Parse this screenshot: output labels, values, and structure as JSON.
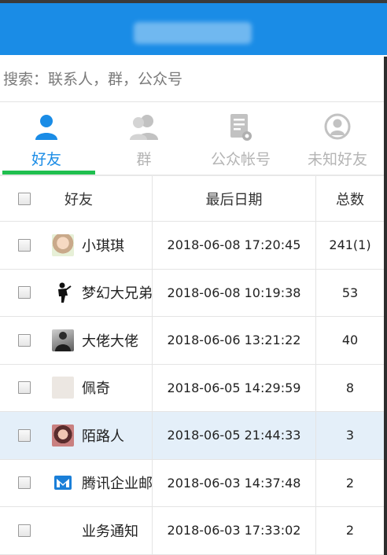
{
  "header": {
    "title": ""
  },
  "search": {
    "placeholder": "搜索：联系人，群，公众号",
    "value": ""
  },
  "tabs": [
    {
      "label": "好友",
      "icon": "user-icon",
      "active": true
    },
    {
      "label": "群",
      "icon": "group-icon",
      "active": false
    },
    {
      "label": "公众帐号",
      "icon": "official-account-icon",
      "active": false
    },
    {
      "label": "未知好友",
      "icon": "unknown-friend-icon",
      "active": false
    }
  ],
  "table": {
    "columns": [
      "好友",
      "最后日期",
      "总数"
    ],
    "rows": [
      {
        "name": "小琪琪",
        "date": "2018-06-08 17:20:45",
        "count": "241(1)",
        "avatar": "photo-avatar"
      },
      {
        "name": "梦幻大兄弟",
        "date": "2018-06-08 10:19:38",
        "count": "53",
        "avatar": "silhouette-avatar"
      },
      {
        "name": "大佬大佬",
        "date": "2018-06-06 13:21:22",
        "count": "40",
        "avatar": "photo-avatar"
      },
      {
        "name": "佩奇",
        "date": "2018-06-05 14:29:59",
        "count": "8",
        "avatar": "photo-avatar"
      },
      {
        "name": "陌路人",
        "date": "2018-06-05 21:44:33",
        "count": "3",
        "avatar": "photo-avatar"
      },
      {
        "name": "腾讯企业邮",
        "date": "2018-06-03 14:37:48",
        "count": "2",
        "avatar": "tencent-mail-icon"
      },
      {
        "name": "业务通知",
        "date": "2018-06-03 17:33:02",
        "count": "2",
        "avatar": ""
      }
    ],
    "selected_row_index": 4
  },
  "colors": {
    "header_bg": "#1a8ce6",
    "active_tab": "#1a8ce6",
    "tab_indicator": "#1fbf4f",
    "selected_row_bg": "#e4eff9"
  }
}
